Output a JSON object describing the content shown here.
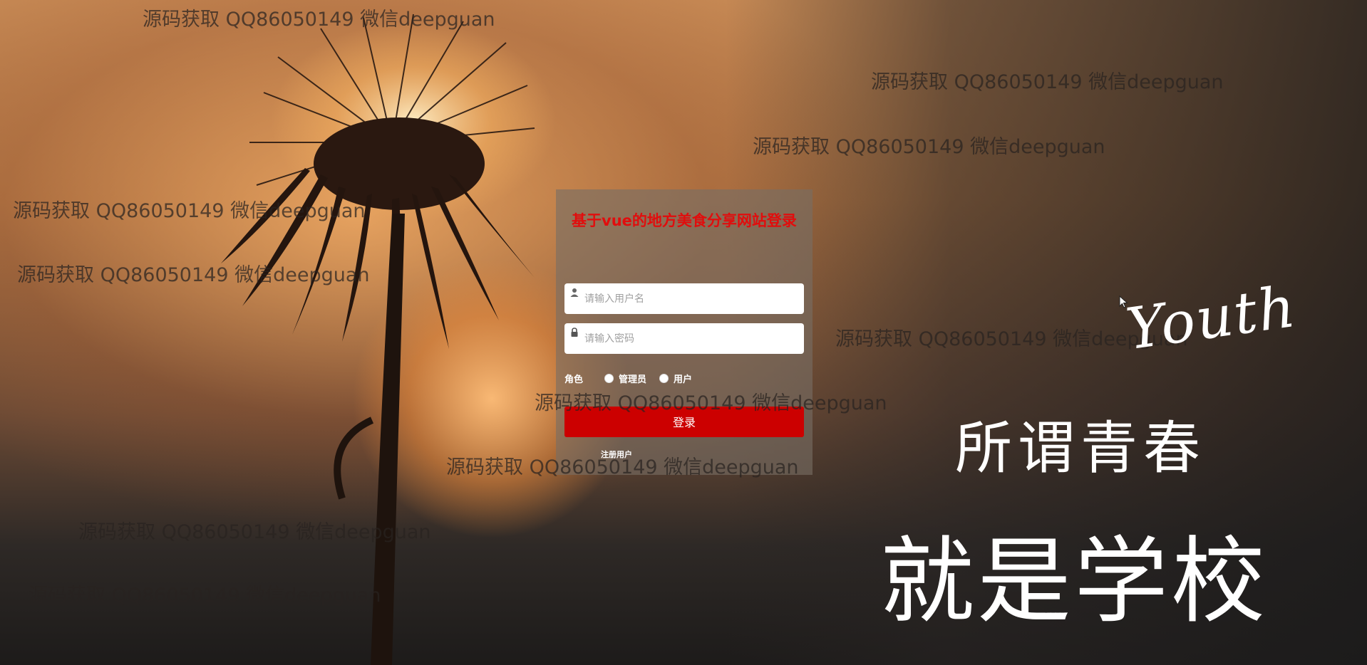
{
  "login": {
    "title": "基于vue的地方美食分享网站登录",
    "username_placeholder": "请输入用户名",
    "password_placeholder": "请输入密码",
    "role_label": "角色",
    "role_options": [
      "管理员",
      "用户"
    ],
    "login_button": "登录",
    "register_link": "注册用户"
  },
  "decor": {
    "youth": "Youth",
    "slogan_line1": "所谓青春",
    "slogan_line2": "就是学校"
  },
  "watermark": {
    "text": "源码获取 QQ86050149 微信deepguan"
  },
  "colors": {
    "accent": "#cc0000",
    "title": "#e10d0d"
  }
}
